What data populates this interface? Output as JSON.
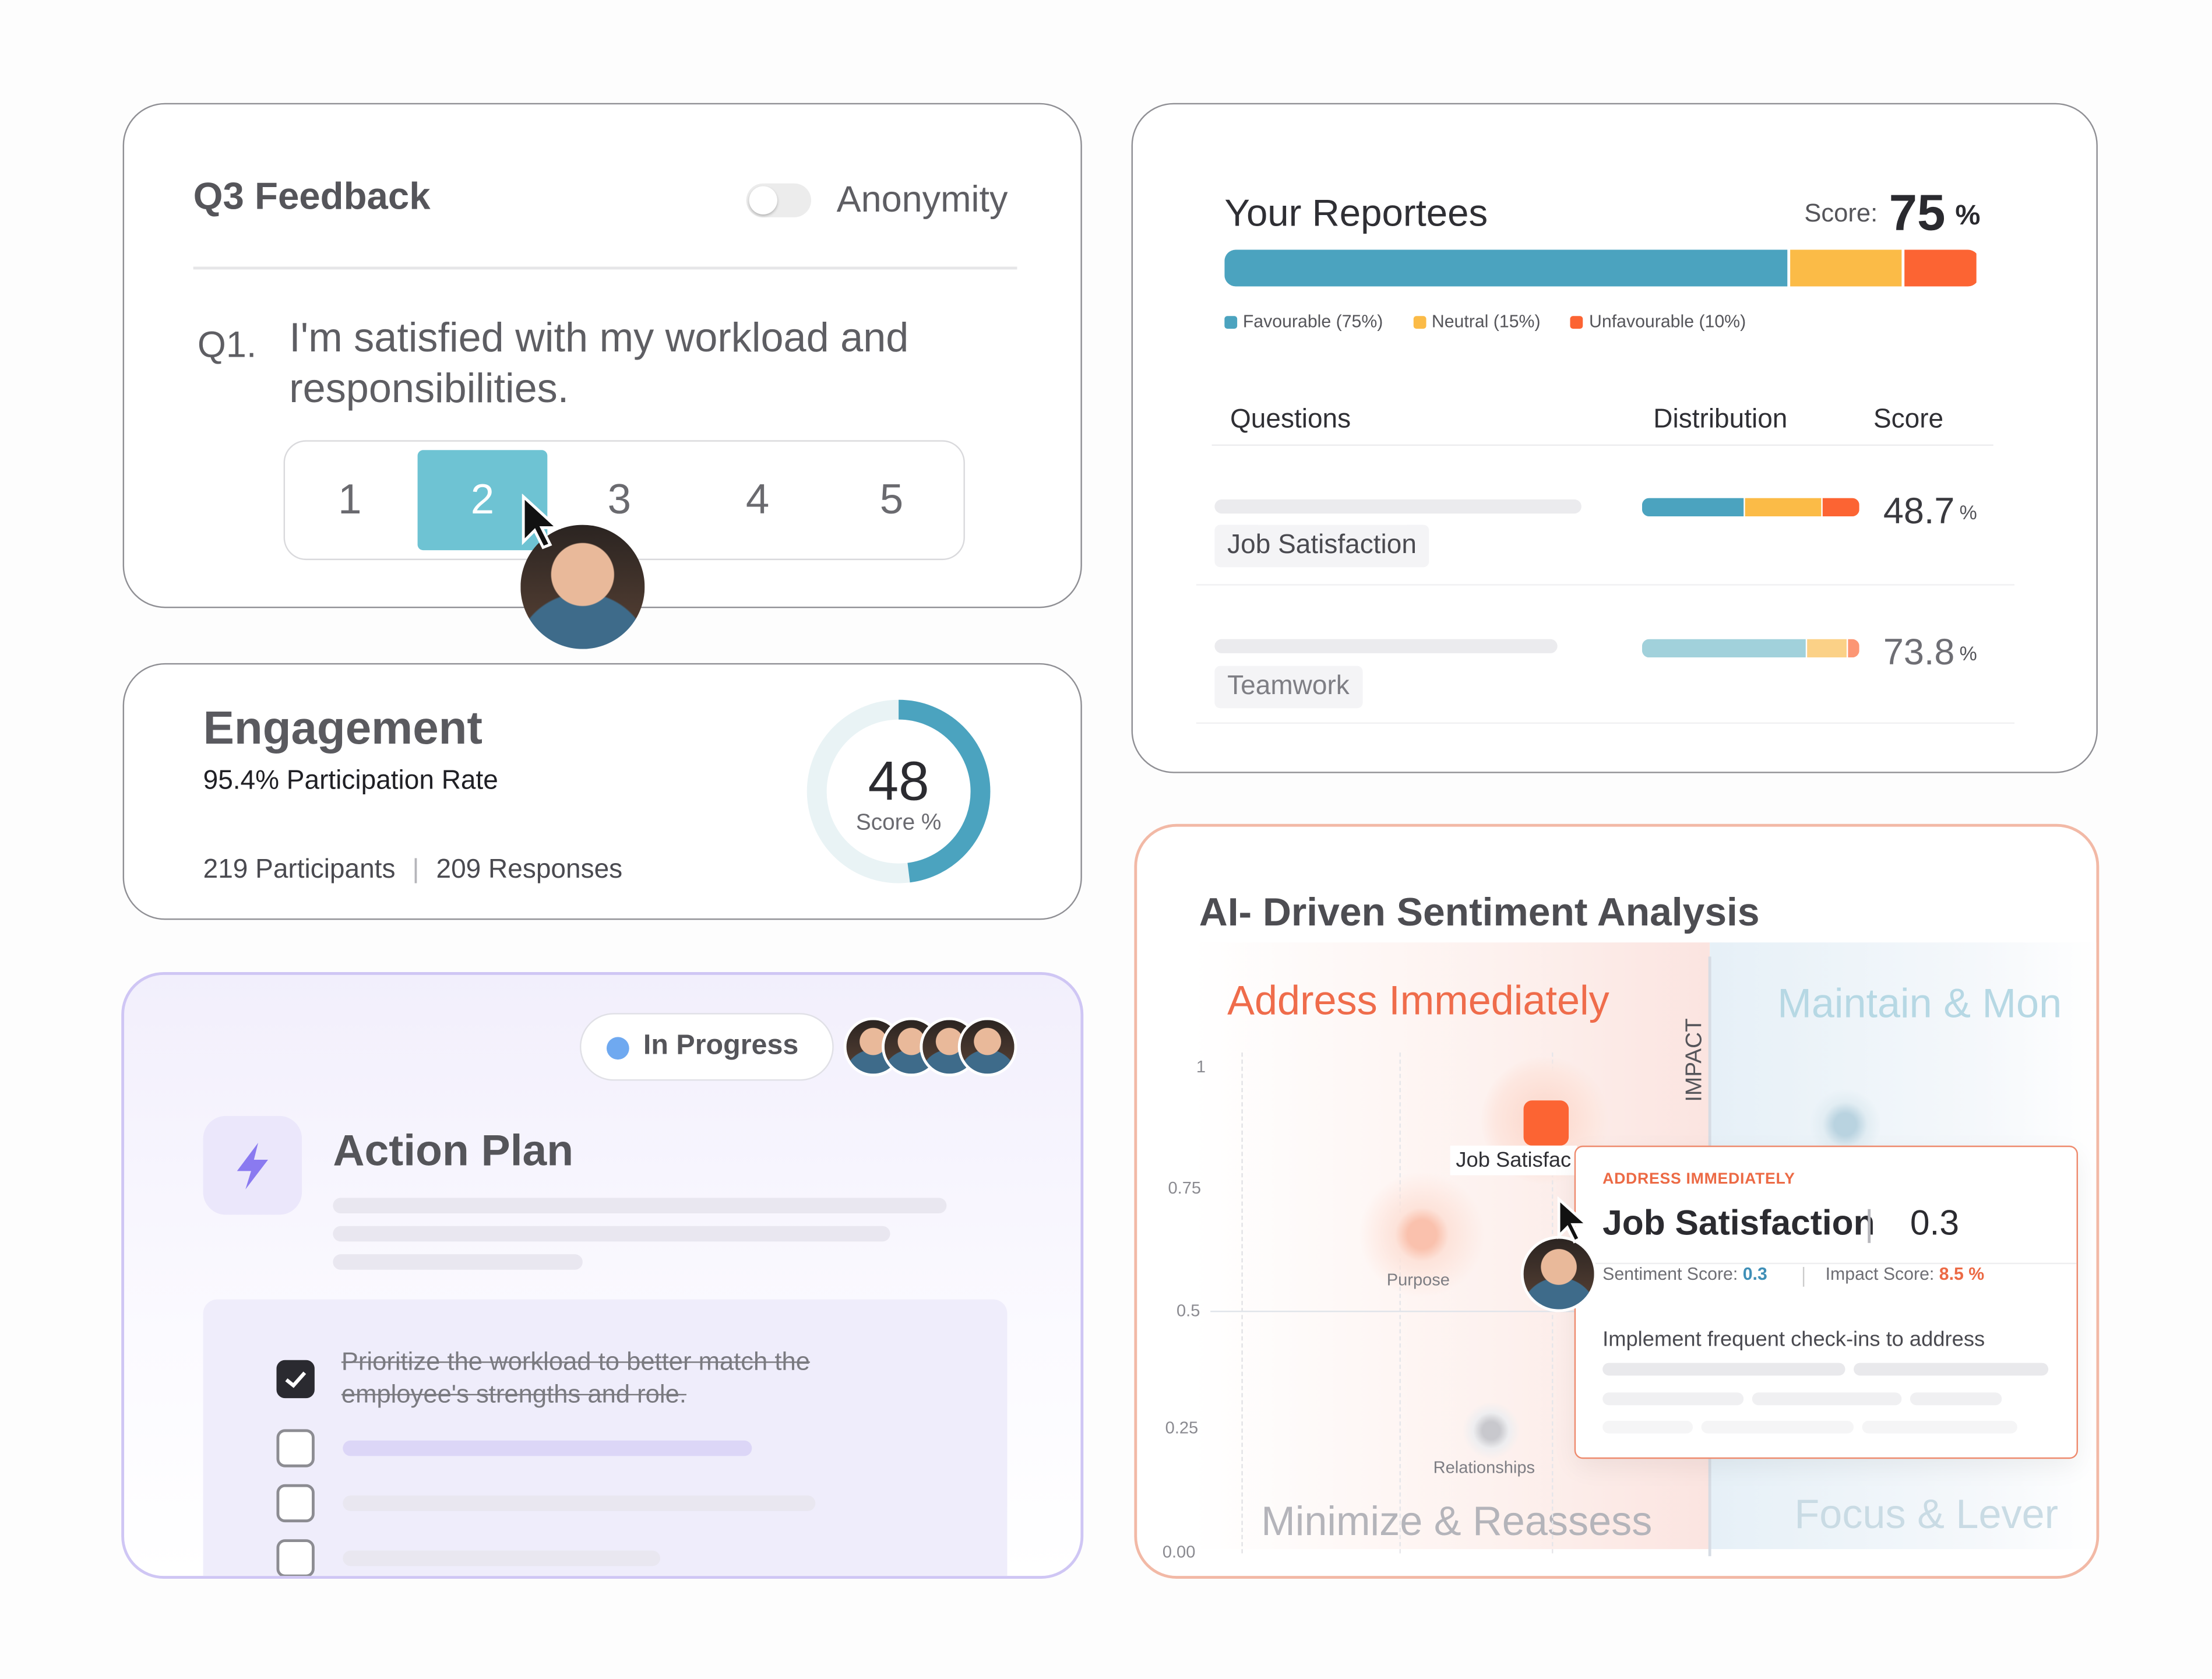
{
  "q3_feedback": {
    "title": "Q3 Feedback",
    "anonymity_label": "Anonymity",
    "anonymity_on": false,
    "question_number": "Q1.",
    "question_text": "I'm satisfied with my workload and responsibilities.",
    "options": [
      "1",
      "2",
      "3",
      "4",
      "5"
    ],
    "selected_option": "2"
  },
  "engagement": {
    "title": "Engagement",
    "participation_rate": "95.4% Participation Rate",
    "participants": "219 Participants",
    "separator": "|",
    "responses": "209 Responses",
    "score_value": "48",
    "score_label": "Score %",
    "score_fraction": 0.48
  },
  "action_plan": {
    "status": "In Progress",
    "title": "Action Plan",
    "tasks": [
      {
        "text": "Prioritize the workload to better match the employee's strengths and role.",
        "checked": true
      }
    ]
  },
  "reportees": {
    "title": "Your Reportees",
    "score_label": "Score:",
    "score_value": "75",
    "score_unit": "%",
    "distribution": [
      {
        "label": "Favourable (75%)",
        "value": 75,
        "color": "#4ba3bf"
      },
      {
        "label": "Neutral (15%)",
        "value": 15,
        "color": "#fbbb47"
      },
      {
        "label": "Unfavourable (10%)",
        "value": 10,
        "color": "#fc6433"
      }
    ],
    "columns": [
      "Questions",
      "Distribution",
      "Score"
    ],
    "rows": [
      {
        "question": "Job Satisfaction",
        "score": "48.7",
        "unit": "%"
      },
      {
        "question": "Teamwork",
        "score": "73.8",
        "unit": "%"
      }
    ]
  },
  "sentiment": {
    "title": "AI- Driven Sentiment Analysis",
    "quadrants": {
      "top_left": "Address Immediately",
      "top_right": "Maintain & Mon",
      "bottom_left": "Minimize & Reassess",
      "bottom_right": "Focus & Lever"
    },
    "axis_label": "IMPACT",
    "y_ticks": [
      "1",
      "0.75",
      "0.5",
      "0.25",
      "0.00"
    ],
    "points": [
      {
        "label": "Job Satisfac",
        "color": "#fc6433"
      },
      {
        "label": "Purpose",
        "color": "#f79a80"
      },
      {
        "label": "Relationships",
        "color": "#a9a9b0"
      }
    ],
    "tooltip": {
      "category": "ADDRESS IMMEDIATELY",
      "name": "Job Satisfaction",
      "value": "0.3",
      "sentiment_label": "Sentiment Score:",
      "sentiment_value": "0.3",
      "impact_label": "Impact Score:",
      "impact_value": "8.5 %",
      "recommendation": "Implement frequent check-ins to address"
    }
  }
}
